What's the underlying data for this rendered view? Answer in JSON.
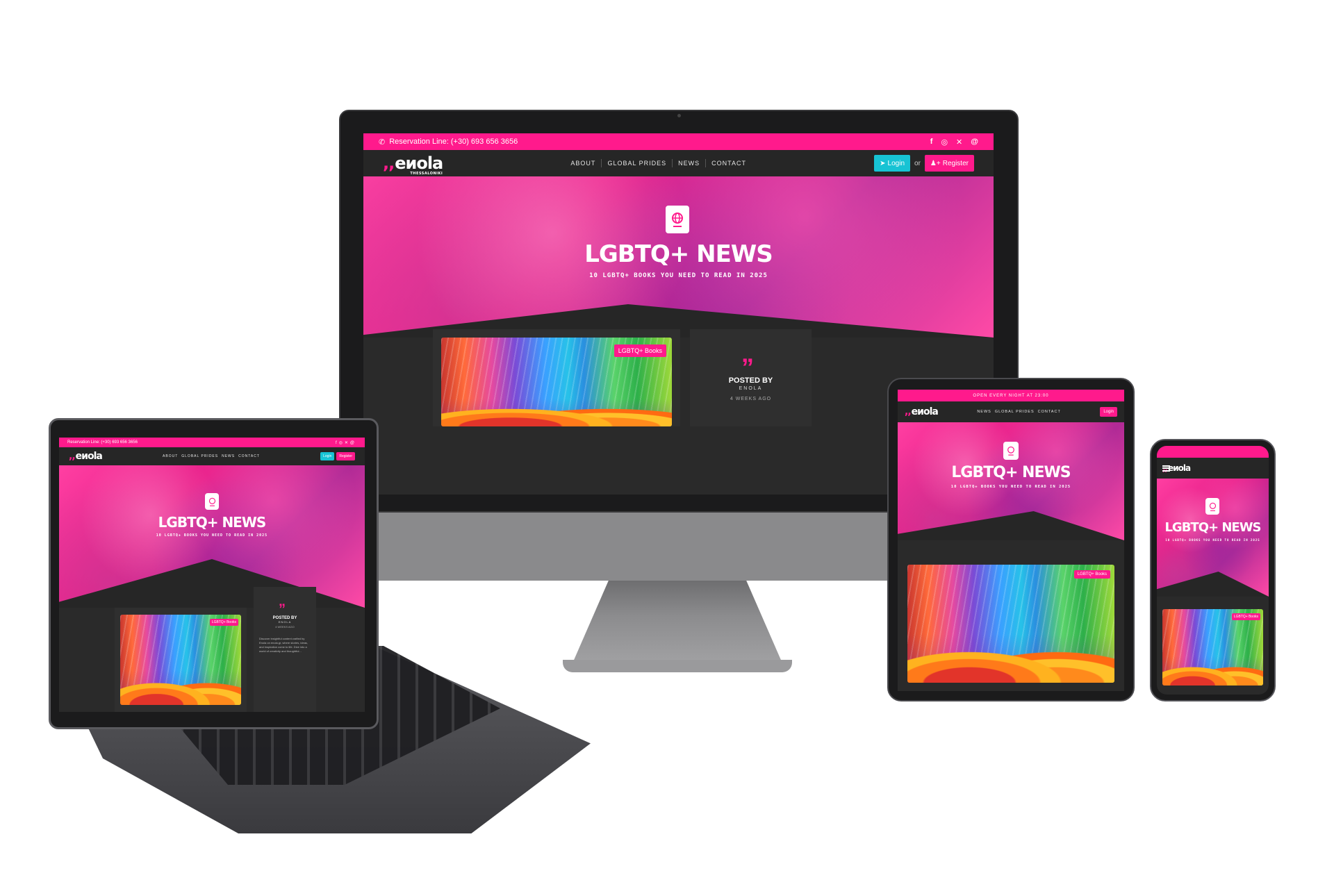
{
  "site": {
    "reservation_line": "Reservation Line: (+30) 693 656 3656",
    "open_notice": "OPEN EVERY NIGHT AT 23:00",
    "logo": "eиola",
    "logo_sub": "THESSALONIKI",
    "nav_desktop": [
      "ABOUT",
      "GLOBAL PRIDES",
      "NEWS",
      "CONTACT"
    ],
    "nav_tablet": [
      "NEWS",
      "GLOBAL PRIDES",
      "CONTACT"
    ],
    "login_label": "Login",
    "or_label": "or",
    "register_label": "Register",
    "social_icons": [
      "facebook-icon",
      "instagram-icon",
      "x-icon",
      "threads-icon"
    ],
    "hero_title": "LGBTQ+ NEWS",
    "hero_subtitle": "10 LGBTQ+ BOOKS YOU NEED TO READ IN 2025",
    "post_tag": "LGBTQ+ Books",
    "posted_by": "POSTED BY",
    "author": "ENOLA",
    "time_ago": "4 WEEKS AGO",
    "laptop_excerpt": "Discover insightful content crafted by Enola on enola.gr, where stories, ideas, and inspiration come to life. Dive into a world of creativity and thoughtful..."
  },
  "colors": {
    "brand_pink": "#ff1a8c",
    "login_cyan": "#17c3d4",
    "dark_bg": "#262626"
  }
}
